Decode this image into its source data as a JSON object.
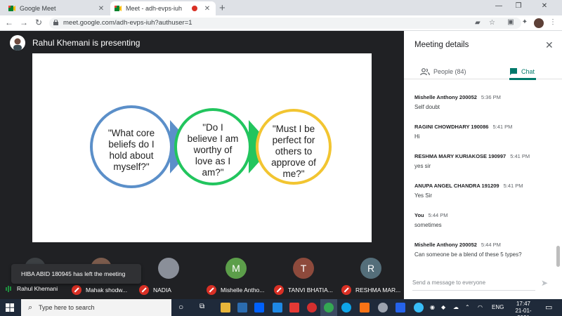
{
  "browser": {
    "tabs": [
      {
        "title": "Google Meet",
        "active": false
      },
      {
        "title": "Meet - adh-evps-iuh",
        "active": true,
        "recording": true
      }
    ],
    "url": "meet.google.com/adh-evps-iuh?authuser=1",
    "window_controls": [
      "minimize",
      "restore",
      "close"
    ]
  },
  "stage": {
    "presenter_label": "Rahul Khemani is presenting",
    "slide": {
      "bubbles": [
        {
          "text": "\"What core beliefs do I hold about myself?\"",
          "color": "#5b8fc9"
        },
        {
          "text": "\"Do I believe I am worthy of love as I am?\"",
          "color": "#22c55e"
        },
        {
          "text": "\"Must I be perfect for others to approve of me?\"",
          "color": "#f2c531"
        }
      ]
    }
  },
  "toast": "HIBA ABID 180945 has left the meeting",
  "participants": [
    {
      "name": "Rahul Khemani",
      "muted": false,
      "speaking": true
    },
    {
      "name": "Mahak shodw...",
      "muted": true
    },
    {
      "name": "NADIA",
      "muted": true,
      "avatar": "photo"
    },
    {
      "name": "Mishelle Antho...",
      "muted": true,
      "initial": "M",
      "color": "#5c9e4a"
    },
    {
      "name": "TANVI BHATIA...",
      "muted": true,
      "initial": "T",
      "color": "#8d4a3c"
    },
    {
      "name": "RESHMA MAR...",
      "muted": true,
      "initial": "R",
      "color": "#546e7a"
    }
  ],
  "panel": {
    "title": "Meeting details",
    "tabs": {
      "people": "People (84)",
      "chat": "Chat"
    },
    "messages": [
      {
        "sender": "Mishelle Anthony 200052",
        "time": "5:36 PM",
        "text": "Self doubt"
      },
      {
        "sender": "RAGINI CHOWDHARY 190086",
        "time": "5:41 PM",
        "text": "Hi"
      },
      {
        "sender": "RESHMA MARY KURIAKOSE 190997",
        "time": "5:41 PM",
        "text": "yes sir"
      },
      {
        "sender": "ANUPA ANGEL CHANDRA 191209",
        "time": "5:41 PM",
        "text": "Yes Sir"
      },
      {
        "sender": "You",
        "time": "5:44 PM",
        "text": "sometimes"
      },
      {
        "sender": "Mishelle Anthony 200052",
        "time": "5:44 PM",
        "text": "Can someone be a blend of these 5 types?"
      }
    ],
    "compose_placeholder": "Send a message to everyone"
  },
  "taskbar": {
    "search_placeholder": "Type here to search",
    "language": "ENG",
    "time": "17:47",
    "date": "21-01-2021"
  }
}
